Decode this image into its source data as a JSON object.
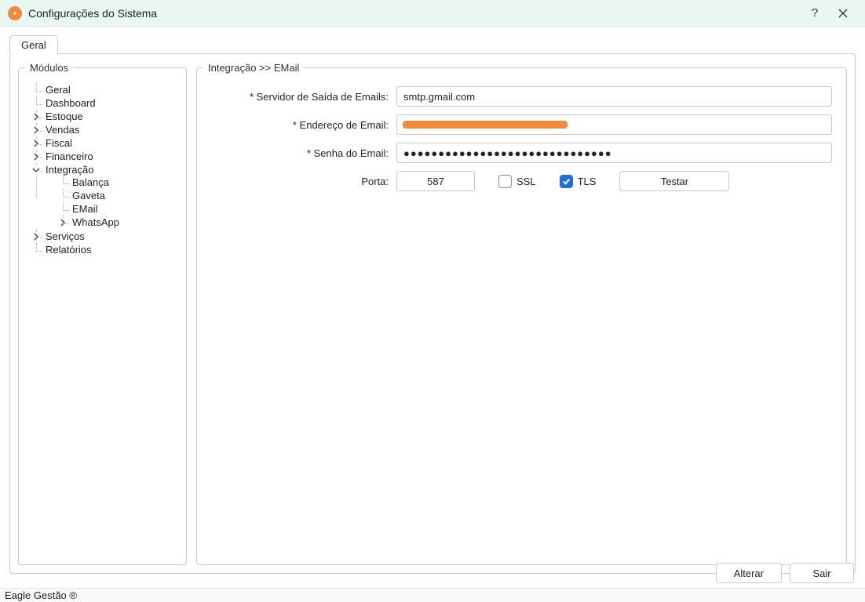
{
  "window": {
    "title": "Configurações do Sistema"
  },
  "tabs": {
    "general": "Geral"
  },
  "sidebar": {
    "legend": "Módulos",
    "items": {
      "geral": "Geral",
      "dashboard": "Dashboard",
      "estoque": "Estoque",
      "vendas": "Vendas",
      "fiscal": "Fiscal",
      "financeiro": "Financeiro",
      "integracao": "Integração",
      "integracao_children": {
        "balanca": "Balança",
        "gaveta": "Gaveta",
        "email": "EMail",
        "whatsapp": "WhatsApp"
      },
      "servicos": "Serviços",
      "relatorios": "Relatórios"
    }
  },
  "main": {
    "legend": "Integração >> EMail",
    "labels": {
      "smtp": "* Servidor de Saída de Emails:",
      "email": "* Endereço de Email:",
      "password": "* Senha do Email:",
      "port": "Porta:",
      "ssl": "SSL",
      "tls": "TLS",
      "test": "Testar"
    },
    "values": {
      "smtp": "smtp.gmail.com",
      "email": "",
      "password": "●●●●●●●●●●●●●●●●●●●●●●●●●●●●●●",
      "port": "587",
      "ssl_checked": false,
      "tls_checked": true
    }
  },
  "footer": {
    "alterar": "Alterar",
    "sair": "Sair"
  },
  "statusbar": "Eagle Gestão ®"
}
